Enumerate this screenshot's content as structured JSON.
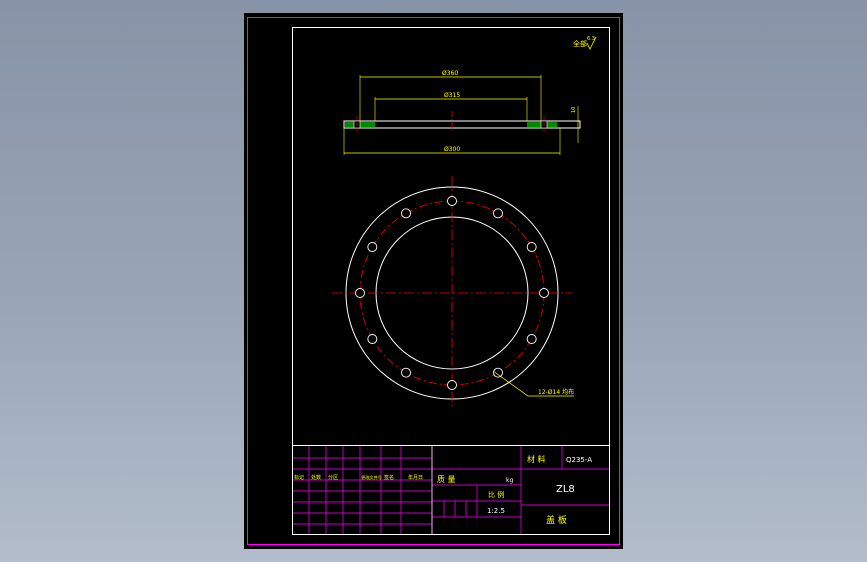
{
  "drawing": {
    "roughness_label": "全部",
    "roughness_value": "6.3",
    "dims": {
      "d_outer": "Ø360",
      "d_bolt": "Ø315",
      "d_total": "Ø300",
      "thickness": "10"
    },
    "hole_callout": "12-Ø14 均布",
    "hole_count": 12
  },
  "title_block": {
    "material_label": "材 料",
    "material_value": "Q235-A",
    "mass_label": "质 量",
    "mass_unit": "kg",
    "scale_label": "比 例",
    "scale_value": "1:2.5",
    "drawing_no": "ZL8",
    "part_name": "盖 板",
    "revision_headers": [
      "标记",
      "处数",
      "分区",
      "更改文件号",
      "签名",
      "年月日"
    ]
  },
  "colors": {
    "background": "#000000",
    "frame": "#ff00ff",
    "geometry": "#ffffff",
    "centerline": "#ff0000",
    "dimension": "#ffff00",
    "hatch": "#00ff00",
    "text": "#ffff00"
  }
}
